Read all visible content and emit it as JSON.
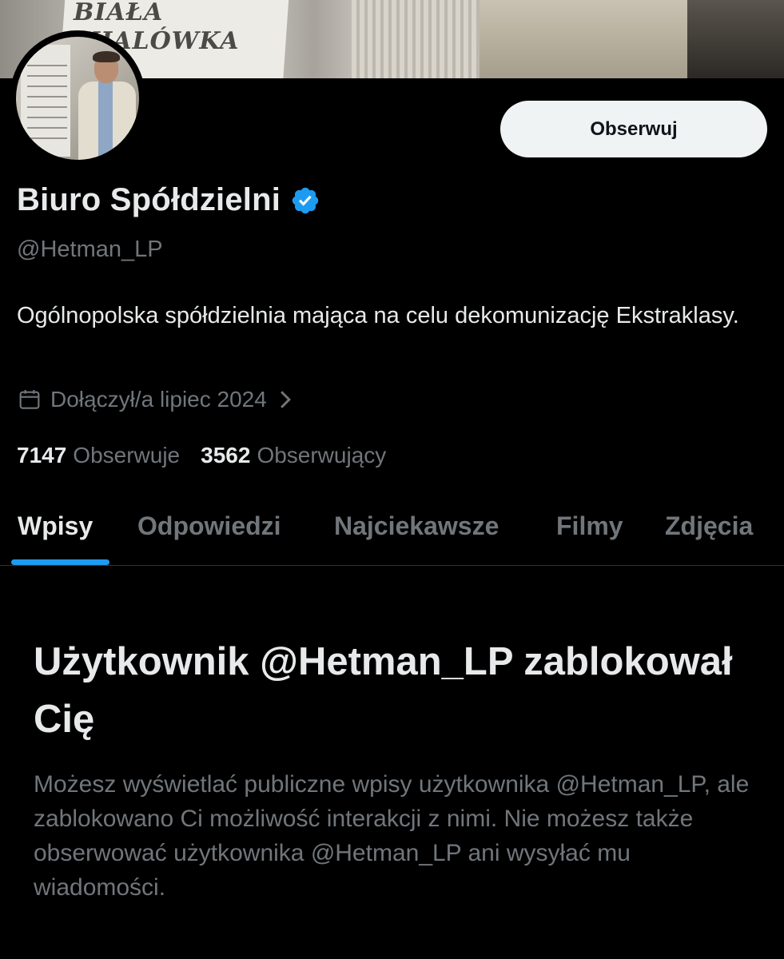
{
  "banner": {
    "sign_text_line1": "BIAŁA",
    "sign_text_line2": "MIALÓWKA"
  },
  "profile": {
    "follow_label": "Obserwuj",
    "display_name": "Biuro Spółdzielni",
    "handle": "@Hetman_LP",
    "bio": "Ogólnopolska spółdzielnia mająca na celu dekomunizację Ekstraklasy.",
    "joined": "Dołączył/a lipiec 2024",
    "following_count": "7147",
    "following_label": "Obserwuje",
    "followers_count": "3562",
    "followers_label": "Obserwujący"
  },
  "tabs": [
    {
      "label": "Wpisy",
      "active": true
    },
    {
      "label": "Odpowiedzi",
      "active": false
    },
    {
      "label": "Najciekawsze",
      "active": false
    },
    {
      "label": "Filmy",
      "active": false
    },
    {
      "label": "Zdjęcia",
      "active": false
    }
  ],
  "blocked": {
    "title": "Użytkownik @Hetman_LP zablokował Cię",
    "body": "Możesz wyświetlać publiczne wpisy użytkownika @Hetman_LP, ale zablokowano Ci możliwość interakcji z nimi. Nie możesz także obserwować użytkownika @Hetman_LP ani wysyłać mu wiadomości."
  },
  "colors": {
    "background": "#000000",
    "text_primary": "#e7e9ea",
    "text_secondary": "#71767b",
    "accent": "#1d9bf0",
    "button_bg": "#eff3f4"
  },
  "icons": {
    "verified": "verified-badge-icon",
    "calendar": "calendar-icon",
    "chevron": "chevron-right-icon"
  }
}
